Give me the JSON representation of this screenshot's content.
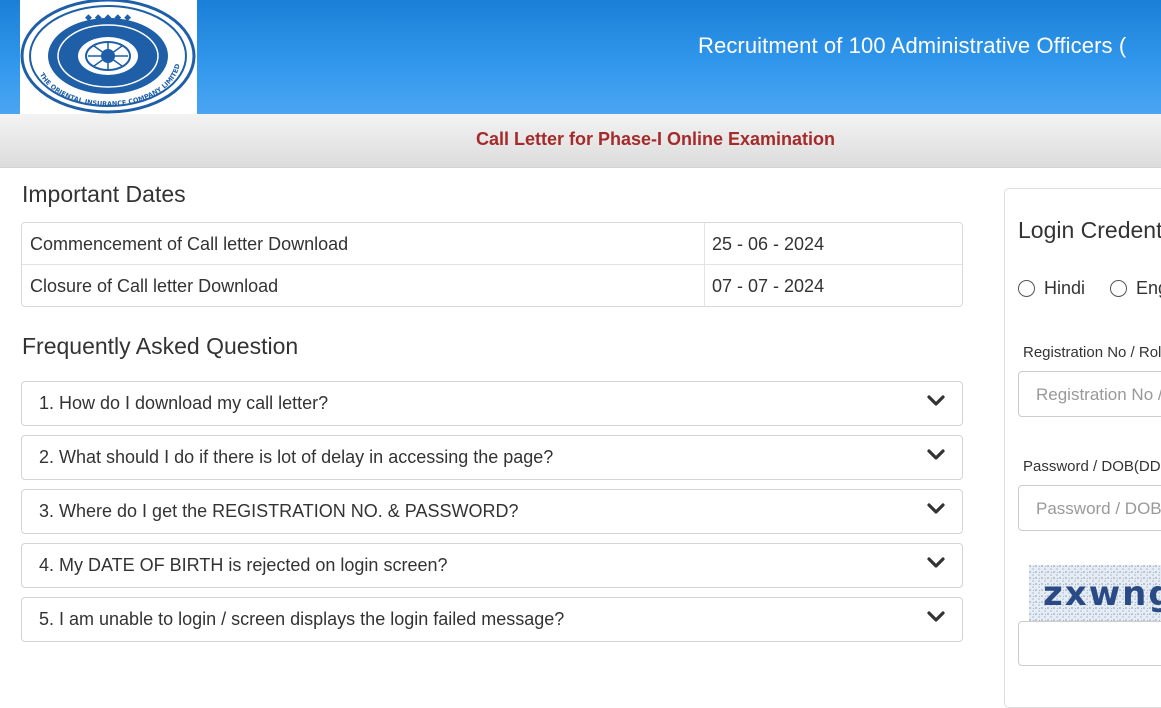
{
  "header": {
    "title": "Recruitment of 100 Administrative Officers (",
    "logo_text": "THE ORIENTAL INSURANCE COMPANY LIMITED"
  },
  "subbar": {
    "title": "Call Letter for Phase-I Online Examination"
  },
  "important_dates": {
    "heading": "Important Dates",
    "rows": [
      {
        "label": "Commencement of Call letter Download",
        "value": "25 - 06 - 2024"
      },
      {
        "label": "Closure of Call letter Download",
        "value": "07 - 07 - 2024"
      }
    ]
  },
  "faq": {
    "heading": "Frequently Asked Question",
    "items": [
      "1. How do I download my call letter?",
      "2. What should I do if there is lot of delay in accessing the page?",
      "3. Where do I get the REGISTRATION NO. & PASSWORD?",
      "4. My DATE OF BIRTH is rejected on login screen?",
      "5. I am unable to login / screen displays the login failed message?"
    ]
  },
  "login": {
    "title": "Login Credentials",
    "languages": [
      "Hindi",
      "English"
    ],
    "registration_label": "Registration No / Roll No",
    "registration_placeholder": "Registration No / Roll No",
    "password_label": "Password / DOB(DD-MM-YY)",
    "password_placeholder": "Password / DOB(DD-MM-YY)",
    "captcha_text": "zxwng"
  },
  "colors": {
    "header_blue": "#3197ec",
    "subbar_title": "#a52a2a"
  }
}
